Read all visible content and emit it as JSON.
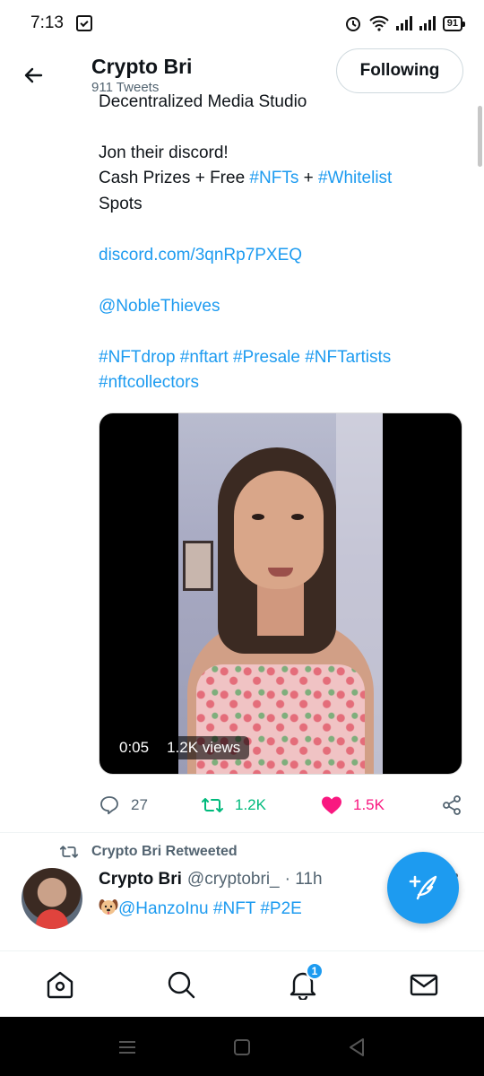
{
  "status": {
    "time": "7:13",
    "battery": "91"
  },
  "header": {
    "title": "Crypto Bri",
    "subtitle": "911 Tweets",
    "follow_label": "Following"
  },
  "tweet": {
    "cutoff_line": "Decentralized Media Studio",
    "line1": "Jon their discord!",
    "line2_prefix": "Cash Prizes + Free ",
    "hashtag_nfts": "#NFTs",
    "plus": " + ",
    "hashtag_whitelist": "#Whitelist",
    "line3": "Spots",
    "link": "discord.com/3qnRp7PXEQ",
    "mention": "@NobleThieves",
    "hashtag_line1": "#NFTdrop #nftart #Presale #NFTartists",
    "hashtag_line2": "#nftcollectors",
    "video_duration": "0:05",
    "video_views": "1.2K views",
    "reply_count": "27",
    "retweet_count": "1.2K",
    "like_count": "1.5K"
  },
  "next_tweet": {
    "retweet_label": "Crypto Bri Retweeted",
    "name": "Crypto Bri",
    "handle": "@cryptobri_",
    "time": "· 11h",
    "text": "@HanzoInu #NFT #P2E"
  },
  "nav": {
    "notification_badge": "1"
  },
  "colors": {
    "accent": "#1d9bf0",
    "retweet": "#00ba7c",
    "like": "#f91880",
    "muted": "#536471"
  },
  "icons": [
    "back-arrow-icon",
    "reply-icon",
    "retweet-icon",
    "heart-icon",
    "share-icon",
    "compose-icon",
    "home-icon",
    "search-icon",
    "bell-icon",
    "mail-icon"
  ]
}
